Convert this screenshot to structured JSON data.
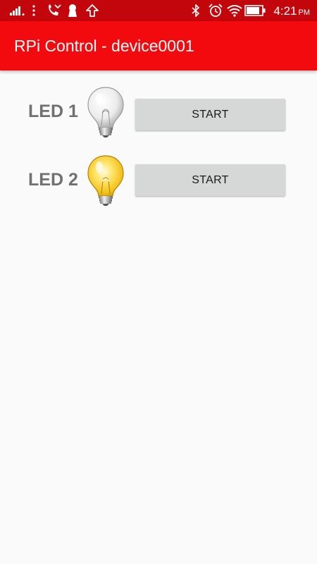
{
  "status_bar": {
    "time": "4:21",
    "ampm": "PM",
    "icons": [
      "signal-icon",
      "more-icon",
      "missed-call-icon",
      "keyhole-icon",
      "upload-icon",
      "bluetooth-icon",
      "alarm-icon",
      "wifi-icon",
      "battery-icon"
    ]
  },
  "app_bar": {
    "title": "RPi Control - device0001"
  },
  "leds": [
    {
      "label": "LED 1",
      "bulb_state": "off",
      "button_label": "START"
    },
    {
      "label": "LED 2",
      "bulb_state": "on",
      "button_label": "START"
    }
  ],
  "colors": {
    "status_bar": "#c3060c",
    "app_bar": "#f20a0f",
    "background": "#fafafa",
    "button": "#d6d7d7",
    "bulb_on": "#f5c518",
    "bulb_off": "#e8e8e8"
  }
}
